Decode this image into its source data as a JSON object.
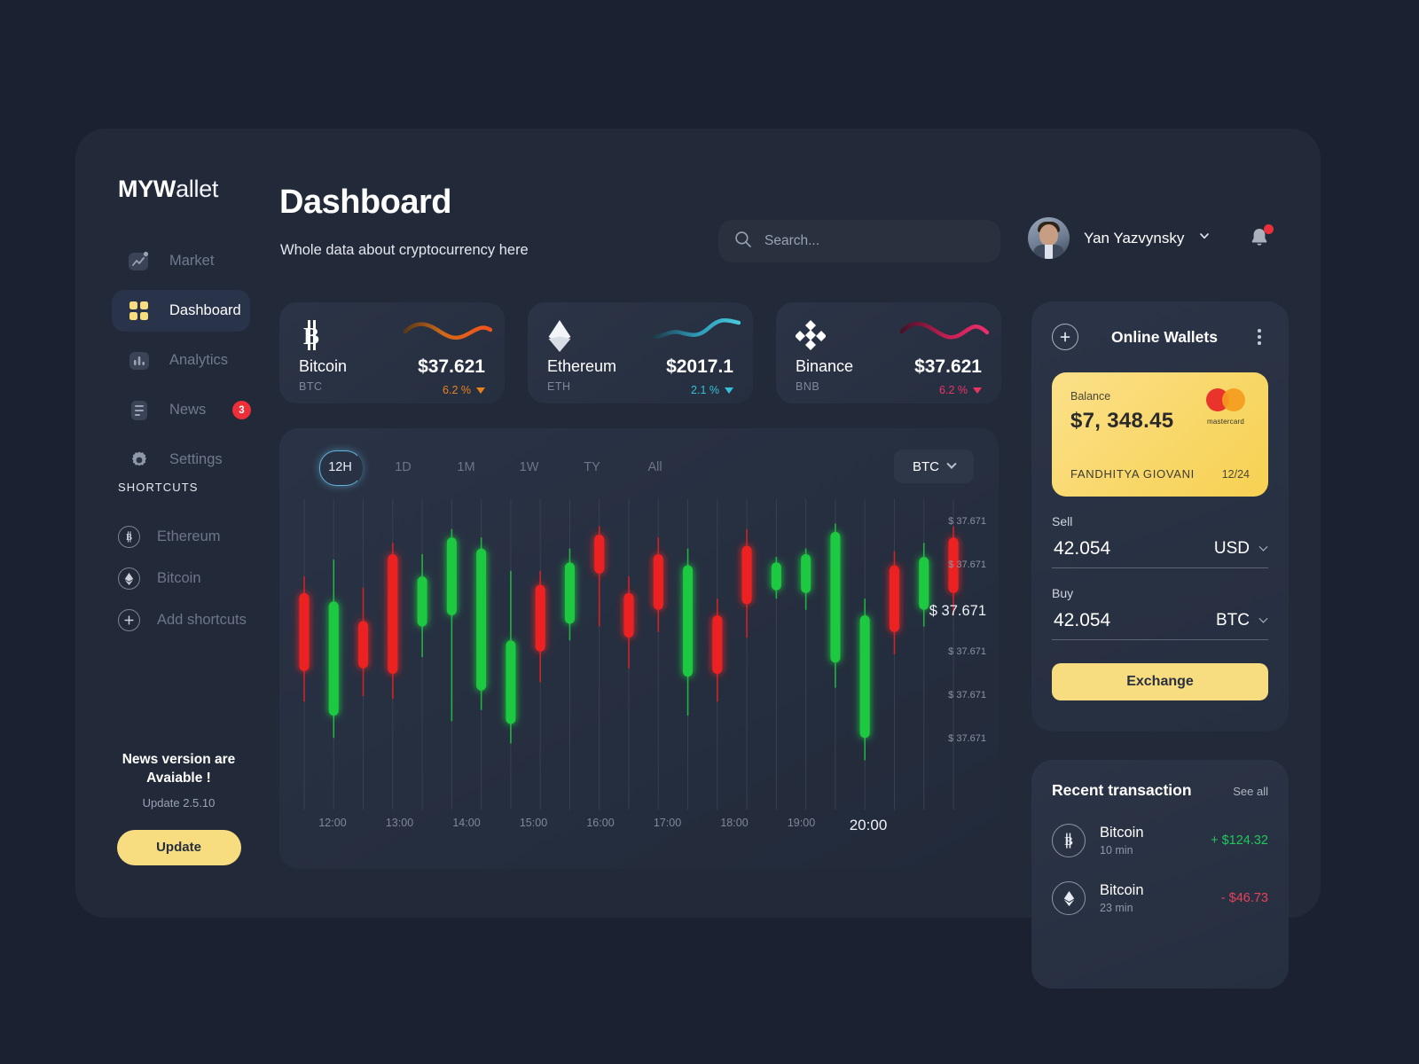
{
  "brand": {
    "bold": "MYW",
    "light": "allet"
  },
  "header": {
    "title": "Dashboard",
    "subtitle": "Whole data about cryptocurrency here",
    "search_placeholder": "Search...",
    "user_name": "Yan Yazvynsky",
    "bell_icon": "bell-icon",
    "chevron_icon": "chevron-down-icon"
  },
  "sidebar": {
    "items": [
      {
        "label": "Market",
        "icon": "market-chart-icon",
        "active": false,
        "badge": null
      },
      {
        "label": "Dashboard",
        "icon": "grid-icon",
        "active": true,
        "badge": null
      },
      {
        "label": "Analytics",
        "icon": "bar-chart-icon",
        "active": false,
        "badge": null
      },
      {
        "label": "News",
        "icon": "news-icon",
        "active": false,
        "badge": "3"
      },
      {
        "label": "Settings",
        "icon": "gear-icon",
        "active": false,
        "badge": null
      }
    ],
    "shortcuts_title": "SHORTCUTS",
    "shortcuts": [
      {
        "label": "Ethereum",
        "icon": "bitcoin-icon"
      },
      {
        "label": "Bitcoin",
        "icon": "ethereum-icon"
      },
      {
        "label": "Add shortcuts",
        "icon": "plus-icon"
      }
    ],
    "news_box": {
      "line1": "News version are",
      "line2": "Avaiable !",
      "version": "Update 2.5.10",
      "button": "Update"
    }
  },
  "coins": [
    {
      "name": "Bitcoin",
      "ticker": "BTC",
      "price": "$37.621",
      "change": "6.2 %",
      "color": "#e8821e",
      "icon": "bitcoin-icon"
    },
    {
      "name": "Ethereum",
      "ticker": "ETH",
      "price": "$2017.1",
      "change": "2.1 %",
      "color": "#34c0d8",
      "icon": "ethereum-icon"
    },
    {
      "name": "Binance",
      "ticker": "BNB",
      "price": "$37.621",
      "change": "6.2 %",
      "color": "#ed3366",
      "icon": "binance-icon"
    }
  ],
  "chart_panel": {
    "ranges": [
      "12H",
      "1D",
      "1M",
      "1W",
      "TY",
      "All"
    ],
    "active_range": "12H",
    "symbol": "BTC"
  },
  "chart_data": {
    "type": "candlestick",
    "title": "",
    "xlabel": "",
    "ylabel": "",
    "grid": true,
    "x_ticks": [
      "12:00",
      "13:00",
      "14:00",
      "15:00",
      "16:00",
      "17:00",
      "18:00",
      "19:00",
      "20:00"
    ],
    "x_tick_highlight": "20:00",
    "y_ticks": [
      "$ 37.671",
      "$ 37.671",
      "$ 37.671",
      "$ 37.671",
      "$ 37.671",
      "$ 37.671"
    ],
    "y_tick_highlight_index": 2,
    "up_color": "#1fc93f",
    "down_color": "#ec2121",
    "candles": [
      {
        "dir": "down",
        "open": 72,
        "close": 44,
        "high": 78,
        "low": 33
      },
      {
        "dir": "up",
        "open": 28,
        "close": 69,
        "high": 84,
        "low": 20
      },
      {
        "dir": "down",
        "open": 62,
        "close": 45,
        "high": 74,
        "low": 35
      },
      {
        "dir": "down",
        "open": 86,
        "close": 43,
        "high": 90,
        "low": 34
      },
      {
        "dir": "up",
        "open": 60,
        "close": 78,
        "high": 86,
        "low": 49
      },
      {
        "dir": "up",
        "open": 64,
        "close": 92,
        "high": 95,
        "low": 26
      },
      {
        "dir": "up",
        "open": 37,
        "close": 88,
        "high": 92,
        "low": 30
      },
      {
        "dir": "up",
        "open": 25,
        "close": 55,
        "high": 80,
        "low": 18
      },
      {
        "dir": "down",
        "open": 75,
        "close": 51,
        "high": 80,
        "low": 40
      },
      {
        "dir": "up",
        "open": 61,
        "close": 83,
        "high": 88,
        "low": 55
      },
      {
        "dir": "down",
        "open": 93,
        "close": 79,
        "high": 96,
        "low": 60
      },
      {
        "dir": "down",
        "open": 72,
        "close": 56,
        "high": 78,
        "low": 45
      },
      {
        "dir": "down",
        "open": 86,
        "close": 66,
        "high": 92,
        "low": 58
      },
      {
        "dir": "up",
        "open": 42,
        "close": 82,
        "high": 88,
        "low": 28
      },
      {
        "dir": "down",
        "open": 64,
        "close": 43,
        "high": 70,
        "low": 33
      },
      {
        "dir": "down",
        "open": 89,
        "close": 68,
        "high": 95,
        "low": 56
      },
      {
        "dir": "up",
        "open": 73,
        "close": 83,
        "high": 85,
        "low": 70
      },
      {
        "dir": "up",
        "open": 72,
        "close": 86,
        "high": 88,
        "low": 66
      },
      {
        "dir": "up",
        "open": 47,
        "close": 94,
        "high": 97,
        "low": 38
      },
      {
        "dir": "up",
        "open": 20,
        "close": 64,
        "high": 70,
        "low": 12
      },
      {
        "dir": "down",
        "open": 82,
        "close": 58,
        "high": 87,
        "low": 50
      },
      {
        "dir": "up",
        "open": 66,
        "close": 85,
        "high": 90,
        "low": 60
      },
      {
        "dir": "down",
        "open": 92,
        "close": 72,
        "high": 96,
        "low": 64
      }
    ]
  },
  "wallets": {
    "title": "Online Wallets",
    "add_icon": "plus-icon",
    "menu_icon": "kebab-menu-icon",
    "card": {
      "balance_label": "Balance",
      "balance": "$7, 348.45",
      "holder": "FANDHITYA GIOVANI",
      "expiry": "12/24",
      "brand": "mastercard"
    },
    "sell_label": "Sell",
    "sell_value": "42.054",
    "sell_currency": "USD",
    "buy_label": "Buy",
    "buy_value": "42.054",
    "buy_currency": "BTC",
    "exchange_button": "Exchange"
  },
  "recent": {
    "title": "Recent transaction",
    "see_all": "See all",
    "items": [
      {
        "name": "Bitcoin",
        "time": "10 min",
        "amount": "+ $124.32",
        "color": "#22c55e",
        "icon": "bitcoin-icon"
      },
      {
        "name": "Bitcoin",
        "time": "23 min",
        "amount": "- $46.73",
        "color": "#e5425b",
        "icon": "ethereum-icon"
      }
    ]
  },
  "colors": {
    "accent": "#f7dd7f",
    "background": "#1b2130",
    "panel": "#222a3a",
    "up": "#1fc93f",
    "down": "#ec2121"
  }
}
